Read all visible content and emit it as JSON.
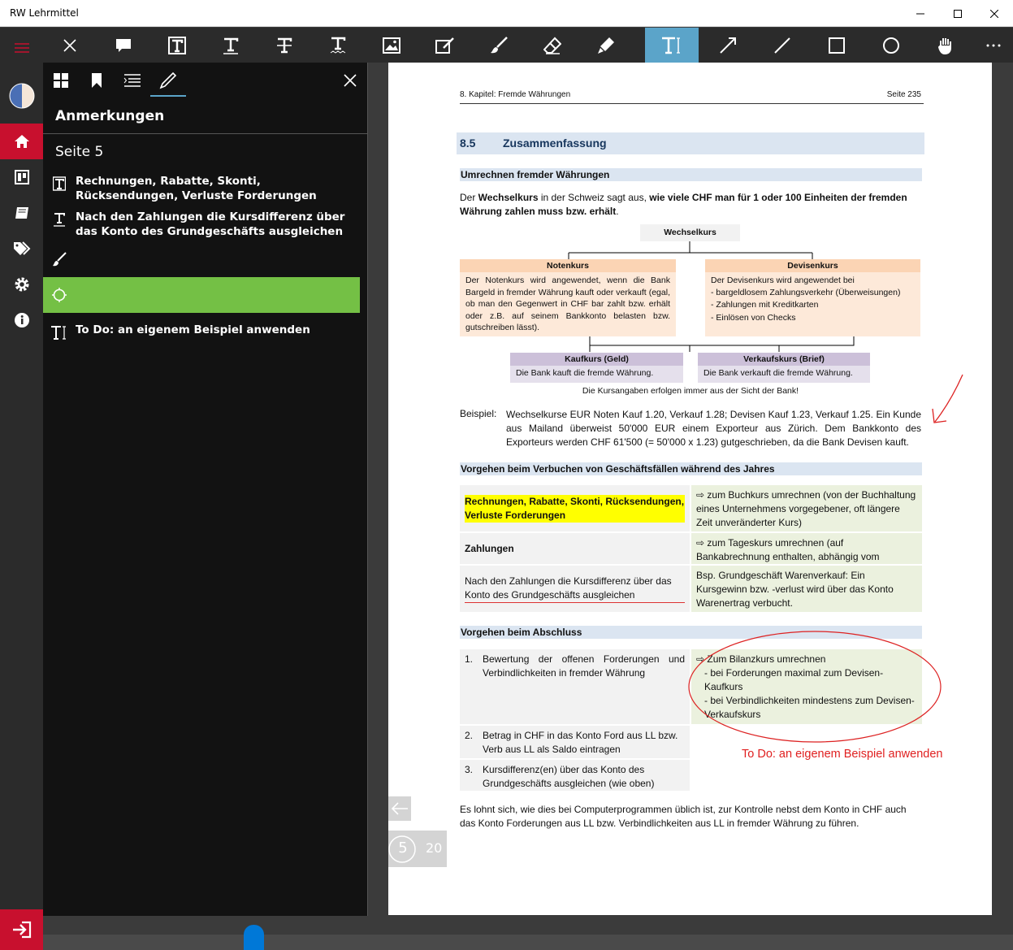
{
  "window": {
    "title": "RW Lehrmittel"
  },
  "panel": {
    "title": "Anmerkungen",
    "page_heading": "Seite 5",
    "annotations": [
      {
        "text": "Rechnungen, Rabatte, Skonti, Rücksendungen, Verluste Forderungen"
      },
      {
        "text": "Nach den Zahlungen die Kursdifferenz über das Konto des Grundgeschäfts ausgleichen"
      },
      {
        "text": ""
      },
      {
        "text": ""
      },
      {
        "text": "To Do: an eigenem Beispiel anwenden"
      }
    ]
  },
  "doc": {
    "header_left": "8. Kapitel: Fremde Währungen",
    "header_right": "Seite 235",
    "section_num": "8.5",
    "section_title": "Zusammenfassung",
    "h_umrechnen": "Umrechnen fremder Währungen",
    "intro_1": "Der ",
    "intro_b1": "Wechselkurs",
    "intro_2": " in der Schweiz sagt aus, ",
    "intro_b2": "wie viele CHF man für 1 oder 100 Einheiten der fremden Währung zahlen muss bzw. erhält",
    "intro_3": ".",
    "diagram": {
      "top": "Wechselkurs",
      "left_title": "Notenkurs",
      "left_text": "Der Notenkurs wird angewendet, wenn die Bank Bargeld in fremder Währung kauft oder verkauft (egal, ob man den Gegenwert in CHF bar zahlt bzw. erhält oder z.B. auf seinem Bankkonto belasten bzw. gutschreiben lässt).",
      "right_title": "Devisenkurs",
      "right_intro": "Der Devisenkurs wird angewendet bei",
      "right_items": [
        "- bargeldlosem Zahlungsverkehr (Überweisungen)",
        "- Zahlungen mit Kreditkarten",
        "- Einlösen von Checks"
      ],
      "buy_title": "Kaufkurs (Geld)",
      "buy_text": "Die Bank kauft die fremde Währung.",
      "sell_title": "Verkaufskurs (Brief)",
      "sell_text": "Die Bank verkauft die fremde Währung.",
      "note": "Die Kursangaben erfolgen immer aus der Sicht der Bank!"
    },
    "beispiel_label": "Beispiel:",
    "beispiel_text": "Wechselkurse EUR Noten Kauf 1.20, Verkauf 1.28; Devisen Kauf 1.23, Verkauf 1.25. Ein Kunde aus Mailand überweist 50'000 EUR einem Exporteur aus Zürich. Dem Bankkonto des Exporteurs werden CHF 61'500 (= 50'000 x 1.23) gutgeschrieben, da die Bank Devisen kauft.",
    "h_vorgehen": "Vorgehen beim Verbuchen von Geschäftsfällen während des Jahres",
    "table1": [
      {
        "left": "Rechnungen, Rabatte, Skonti, Rücksendungen, Verluste Forderungen",
        "right": "⇨ zum Buchkurs umrechnen (von der Buchhaltung eines Unternehmens vorgegebener, oft längere Zeit unveränderter Kurs)"
      },
      {
        "left": "Zahlungen",
        "right": "⇨ zum Tageskurs umrechnen (auf Bankabrechnung enthalten, abhängig vom Devisenmarkt)"
      },
      {
        "left": "Nach den Zahlungen die Kursdifferenz über das Konto des Grundgeschäfts ausgleichen",
        "right": "Bsp. Grundgeschäft Warenverkauf: Ein Kursgewinn bzw. -verlust wird über das Konto Warenertrag verbucht."
      }
    ],
    "h_abschluss": "Vorgehen beim Abschluss",
    "table2": [
      {
        "num": "1.",
        "left": "Bewertung der offenen Forderungen und Verbindlichkeiten in fremder Währung"
      },
      {
        "num": "2.",
        "left": "Betrag in CHF in das Konto Ford aus LL bzw. Verb aus LL als Saldo eintragen"
      },
      {
        "num": "3.",
        "left": "Kursdifferenz(en) über das Konto des Grundgeschäfts ausgleichen (wie oben)"
      }
    ],
    "abschluss_right_1": "⇨ Zum Bilanzkurs umrechnen",
    "abschluss_right_2": "- bei Forderungen maximal zum Devisen-Kaufkurs",
    "abschluss_right_3": "- bei Verbindlichkeiten mindestens zum Devisen-Verkaufskurs",
    "todo_note": "To Do: an eigenem Beispiel anwenden",
    "closing": "Es lohnt sich, wie dies bei Computerprogrammen üblich ist, zur Kontrolle nebst dem Konto in CHF auch das Konto Forderungen aus LL bzw. Verbindlichkeiten aus LL in fremder Währung zu führen."
  },
  "pager": {
    "current": "5",
    "total": "20"
  },
  "colors": {
    "accent_red": "#c8102e",
    "tool_active": "#5ba4c9",
    "selected_annotation": "#74c045"
  }
}
